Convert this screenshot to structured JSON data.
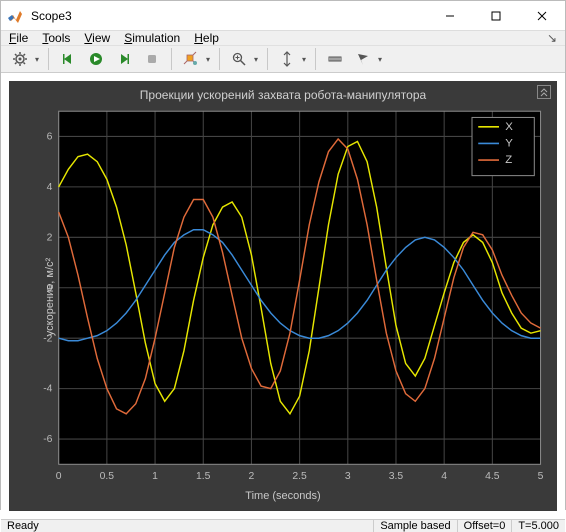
{
  "window": {
    "title": "Scope3"
  },
  "menubar": [
    {
      "ul": "F",
      "rest": "ile"
    },
    {
      "ul": "T",
      "rest": "ools"
    },
    {
      "ul": "V",
      "rest": "iew"
    },
    {
      "ul": "S",
      "rest": "imulation"
    },
    {
      "ul": "H",
      "rest": "elp"
    }
  ],
  "toolbar": {
    "configure": "Configuration Properties",
    "step_back": "Step Back",
    "run": "Run",
    "step_forward": "Step Forward",
    "stop": "Stop",
    "highlight": "Highlight Simulink Block",
    "zoom": "Zoom",
    "autoscale": "Scale Y Axis Limits",
    "measurements": "Cursor Measurements",
    "triggers": "Triggers"
  },
  "statusbar": {
    "ready": "Ready",
    "sample_mode": "Sample based",
    "offset": "Offset=0",
    "time": "T=5.000"
  },
  "chart_data": {
    "type": "line",
    "title": "Проекции ускорений захвата робота-манипулятора",
    "xlabel": "Time (seconds)",
    "ylabel": "ускорение, м/с²",
    "xlim": [
      0,
      5
    ],
    "ylim": [
      -7,
      7
    ],
    "xticks": [
      0,
      0.5,
      1,
      1.5,
      2,
      2.5,
      3,
      3.5,
      4,
      4.5,
      5
    ],
    "yticks": [
      -6,
      -4,
      -2,
      0,
      2,
      4,
      6
    ],
    "legend_position": "top-right",
    "colors": {
      "X": "#e6e600",
      "Y": "#3a8ad8",
      "Z": "#e06a3a"
    },
    "x": [
      0,
      0.1,
      0.2,
      0.3,
      0.4,
      0.5,
      0.6,
      0.7,
      0.8,
      0.9,
      1.0,
      1.1,
      1.2,
      1.3,
      1.4,
      1.5,
      1.6,
      1.7,
      1.8,
      1.9,
      2.0,
      2.1,
      2.2,
      2.3,
      2.4,
      2.5,
      2.6,
      2.7,
      2.8,
      2.9,
      3.0,
      3.1,
      3.2,
      3.3,
      3.4,
      3.5,
      3.6,
      3.7,
      3.8,
      3.9,
      4.0,
      4.1,
      4.2,
      4.3,
      4.4,
      4.5,
      4.6,
      4.7,
      4.8,
      4.9,
      5.0
    ],
    "series": [
      {
        "name": "X",
        "values": [
          4.0,
          4.7,
          5.2,
          5.3,
          5.0,
          4.3,
          3.2,
          1.7,
          -0.2,
          -2.2,
          -3.8,
          -4.5,
          -4.0,
          -2.5,
          -0.5,
          1.2,
          2.5,
          3.2,
          3.4,
          2.8,
          1.3,
          -0.8,
          -3.0,
          -4.5,
          -5.0,
          -4.3,
          -2.5,
          0.0,
          2.5,
          4.5,
          5.6,
          5.8,
          5.0,
          3.2,
          0.8,
          -1.5,
          -3.0,
          -3.5,
          -2.8,
          -1.5,
          -0.2,
          1.0,
          1.8,
          2.1,
          1.8,
          1.0,
          -0.2,
          -1.0,
          -1.6,
          -1.8,
          -1.7
        ]
      },
      {
        "name": "Y",
        "values": [
          -2.0,
          -2.1,
          -2.1,
          -2.0,
          -1.9,
          -1.7,
          -1.4,
          -1.0,
          -0.5,
          0.1,
          0.7,
          1.3,
          1.8,
          2.1,
          2.3,
          2.3,
          2.1,
          1.8,
          1.3,
          0.7,
          0.1,
          -0.5,
          -1.0,
          -1.4,
          -1.7,
          -1.9,
          -2.0,
          -2.0,
          -1.9,
          -1.7,
          -1.4,
          -1.0,
          -0.5,
          0.1,
          0.7,
          1.2,
          1.6,
          1.9,
          2.0,
          1.9,
          1.6,
          1.2,
          0.7,
          0.1,
          -0.5,
          -1.0,
          -1.4,
          -1.7,
          -1.9,
          -2.0,
          -2.0
        ]
      },
      {
        "name": "Z",
        "values": [
          3.0,
          2.0,
          0.5,
          -1.2,
          -2.8,
          -4.0,
          -4.8,
          -5.0,
          -4.6,
          -3.6,
          -2.0,
          -0.2,
          1.6,
          2.8,
          3.5,
          3.5,
          2.8,
          1.4,
          -0.3,
          -2.0,
          -3.2,
          -3.9,
          -4.0,
          -3.3,
          -1.8,
          0.3,
          2.5,
          4.2,
          5.4,
          5.9,
          5.5,
          4.3,
          2.5,
          0.3,
          -1.8,
          -3.3,
          -4.2,
          -4.5,
          -4.0,
          -2.8,
          -1.2,
          0.4,
          1.6,
          2.2,
          2.1,
          1.5,
          0.5,
          -0.3,
          -1.0,
          -1.4,
          -1.6
        ]
      }
    ]
  }
}
